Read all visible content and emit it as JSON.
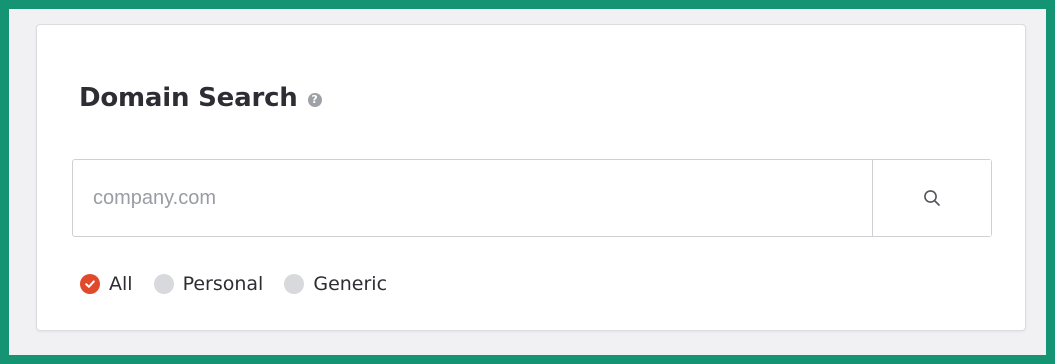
{
  "header": {
    "title": "Domain Search",
    "help_icon": "?"
  },
  "search": {
    "placeholder": "company.com",
    "value": "",
    "button_icon": "search-icon"
  },
  "filters": [
    {
      "label": "All",
      "checked": true
    },
    {
      "label": "Personal",
      "checked": false
    },
    {
      "label": "Generic",
      "checked": false
    }
  ],
  "colors": {
    "frame": "#159473",
    "accent": "#e0492b",
    "radio_unchecked": "#d8d9dc",
    "text": "#2d2d33",
    "placeholder": "#9a9ca3"
  }
}
